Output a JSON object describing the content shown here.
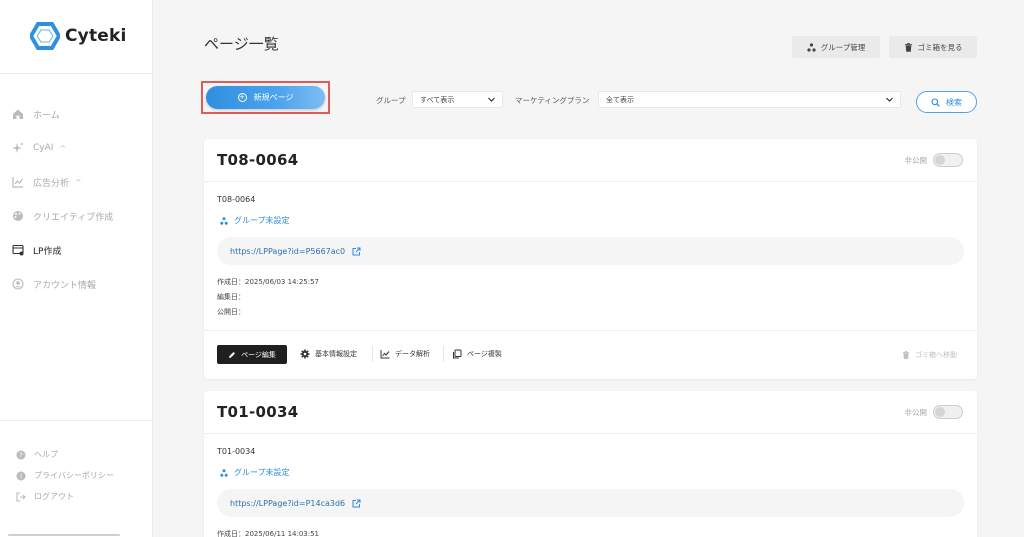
{
  "app": {
    "name": "Cyteki",
    "accent": "#2d8de0",
    "brand": "#2f8fe0"
  },
  "sidebar": {
    "items": [
      {
        "label": "ホーム",
        "icon": "home-icon"
      },
      {
        "label": "CyAI",
        "icon": "sparkle-icon",
        "chevron": "^"
      },
      {
        "label": "広告分析",
        "icon": "chart-icon",
        "chevron": "^"
      },
      {
        "label": "クリエイティブ作成",
        "icon": "palette-icon"
      },
      {
        "label": "LP作成",
        "icon": "lp-icon",
        "active": true
      },
      {
        "label": "アカウント情報",
        "icon": "user-icon"
      }
    ],
    "footer": [
      {
        "label": "ヘルプ",
        "icon": "help-icon"
      },
      {
        "label": "プライバシーポリシー",
        "icon": "info-icon"
      },
      {
        "label": "ログアウト",
        "icon": "logout-icon"
      }
    ]
  },
  "header": {
    "title": "ページ一覧",
    "group_manage": "グループ管理",
    "trash_view": "ゴミ箱を見る"
  },
  "toolbar": {
    "new_page": "新規ページ",
    "group_label": "グループ",
    "group_value": "すべて表示",
    "plan_label": "マーケティングプラン",
    "plan_value": "全て表示",
    "search": "検索"
  },
  "cards": [
    {
      "title": "T08-0064",
      "public_label": "非公開",
      "name": "T08-0064",
      "group": "グループ未設定",
      "url": "https://LPPage?id=P5667ac0",
      "created": "作成日：2025/06/03 14:25:57",
      "edited": "編集日：",
      "published": "公開日：",
      "actions": {
        "edit": "ページ編集",
        "settings": "基本情報設定",
        "analytics": "データ解析",
        "duplicate": "ページ複製",
        "trash": "ゴミ箱へ移動"
      }
    },
    {
      "title": "T01-0034",
      "public_label": "非公開",
      "name": "T01-0034",
      "group": "グループ未設定",
      "url": "https://LPPage?id=P14ca3d6",
      "created": "作成日：2025/06/11 14:03:51"
    }
  ]
}
